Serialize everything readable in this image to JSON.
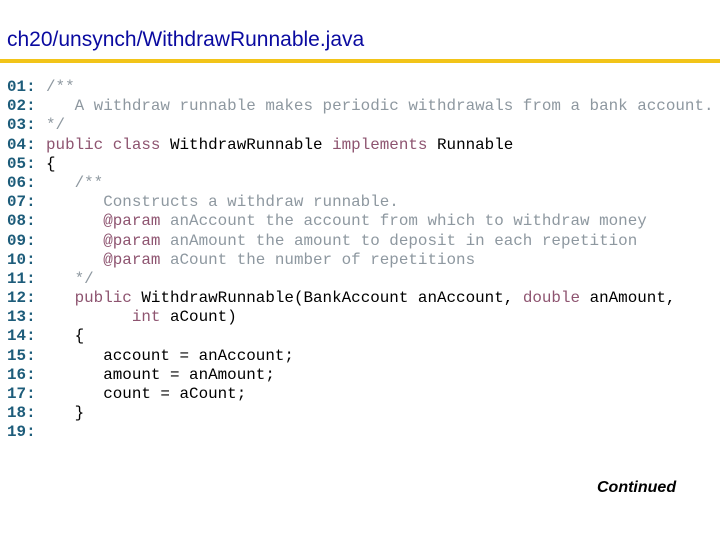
{
  "slide": {
    "title": "ch20/unsynch/WithdrawRunnable.java",
    "footer": "Continued"
  },
  "colors": {
    "title": "#0a0aa0",
    "rule": "#f2c418",
    "line_number": "#1d5c7a",
    "comment": "#8e98a0",
    "keyword": "#8e5470",
    "plain": "#000000"
  },
  "code": {
    "lines": [
      {
        "num": "01:",
        "tokens": [
          {
            "t": "cm",
            "s": "/**"
          }
        ]
      },
      {
        "num": "02:",
        "tokens": [
          {
            "t": "cm",
            "s": "   A withdraw runnable makes periodic withdrawals from a bank account."
          }
        ]
      },
      {
        "num": "03:",
        "tokens": [
          {
            "t": "cm",
            "s": "*/"
          }
        ]
      },
      {
        "num": "04:",
        "tokens": [
          {
            "t": "kw",
            "s": "public class "
          },
          {
            "t": "pl",
            "s": "WithdrawRunnable "
          },
          {
            "t": "kw",
            "s": "implements "
          },
          {
            "t": "pl",
            "s": "Runnable"
          }
        ]
      },
      {
        "num": "05:",
        "tokens": [
          {
            "t": "pl",
            "s": "{"
          }
        ]
      },
      {
        "num": "06:",
        "tokens": [
          {
            "t": "cm",
            "s": "   /**"
          }
        ]
      },
      {
        "num": "07:",
        "tokens": [
          {
            "t": "cm",
            "s": "      Constructs a withdraw runnable."
          }
        ]
      },
      {
        "num": "08:",
        "tokens": [
          {
            "t": "cm",
            "s": "      "
          },
          {
            "t": "kw",
            "s": "@param"
          },
          {
            "t": "cm",
            "s": " anAccount the account from which to withdraw money"
          }
        ]
      },
      {
        "num": "09:",
        "tokens": [
          {
            "t": "cm",
            "s": "      "
          },
          {
            "t": "kw",
            "s": "@param"
          },
          {
            "t": "cm",
            "s": " anAmount the amount to deposit in each repetition"
          }
        ]
      },
      {
        "num": "10:",
        "tokens": [
          {
            "t": "cm",
            "s": "      "
          },
          {
            "t": "kw",
            "s": "@param"
          },
          {
            "t": "cm",
            "s": " aCount the number of repetitions"
          }
        ]
      },
      {
        "num": "11:",
        "tokens": [
          {
            "t": "cm",
            "s": "   */"
          }
        ]
      },
      {
        "num": "12:",
        "tokens": [
          {
            "t": "pl",
            "s": "   "
          },
          {
            "t": "kw",
            "s": "public "
          },
          {
            "t": "pl",
            "s": "WithdrawRunnable(BankAccount anAccount, "
          },
          {
            "t": "kw",
            "s": "double "
          },
          {
            "t": "pl",
            "s": "anAmount,"
          }
        ]
      },
      {
        "num": "13:",
        "tokens": [
          {
            "t": "pl",
            "s": "         "
          },
          {
            "t": "kw",
            "s": "int "
          },
          {
            "t": "pl",
            "s": "aCount)"
          }
        ]
      },
      {
        "num": "14:",
        "tokens": [
          {
            "t": "pl",
            "s": "   {"
          }
        ]
      },
      {
        "num": "15:",
        "tokens": [
          {
            "t": "pl",
            "s": "      account = anAccount;"
          }
        ]
      },
      {
        "num": "16:",
        "tokens": [
          {
            "t": "pl",
            "s": "      amount = anAmount;"
          }
        ]
      },
      {
        "num": "17:",
        "tokens": [
          {
            "t": "pl",
            "s": "      count = aCount;"
          }
        ]
      },
      {
        "num": "18:",
        "tokens": [
          {
            "t": "pl",
            "s": "   }"
          }
        ]
      },
      {
        "num": "19:",
        "tokens": []
      }
    ]
  }
}
